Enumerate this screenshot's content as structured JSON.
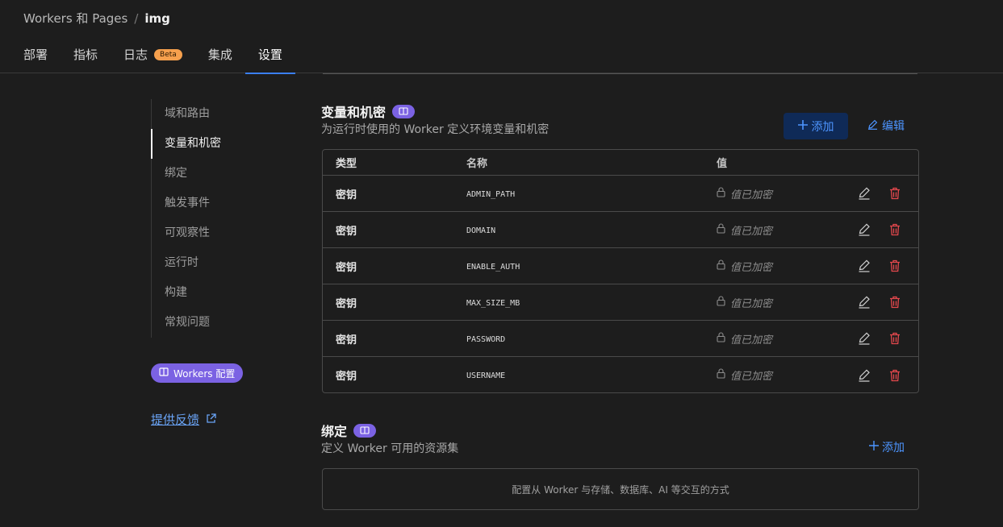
{
  "breadcrumb": {
    "parent": "Workers 和 Pages",
    "separator": "/",
    "current": "img"
  },
  "tabs": [
    {
      "label": "部署"
    },
    {
      "label": "指标"
    },
    {
      "label": "日志",
      "badge": "Beta"
    },
    {
      "label": "集成"
    },
    {
      "label": "设置",
      "active": true
    }
  ],
  "sidenav": {
    "items": [
      {
        "label": "域和路由"
      },
      {
        "label": "变量和机密",
        "active": true
      },
      {
        "label": "绑定"
      },
      {
        "label": "触发事件"
      },
      {
        "label": "可观察性"
      },
      {
        "label": "运行时"
      },
      {
        "label": "构建"
      },
      {
        "label": "常规问题"
      }
    ],
    "workers_badge": "Workers 配置",
    "feedback": "提供反馈"
  },
  "variables": {
    "title": "变量和机密",
    "subtitle": "为运行时使用的 Worker 定义环境变量和机密",
    "add_label": "添加",
    "edit_label": "编辑",
    "columns": {
      "type": "类型",
      "name": "名称",
      "value": "值"
    },
    "rows": [
      {
        "type": "密钥",
        "name": "ADMIN_PATH",
        "value": "值已加密"
      },
      {
        "type": "密钥",
        "name": "DOMAIN",
        "value": "值已加密"
      },
      {
        "type": "密钥",
        "name": "ENABLE_AUTH",
        "value": "值已加密"
      },
      {
        "type": "密钥",
        "name": "MAX_SIZE_MB",
        "value": "值已加密"
      },
      {
        "type": "密钥",
        "name": "PASSWORD",
        "value": "值已加密"
      },
      {
        "type": "密钥",
        "name": "USERNAME",
        "value": "值已加密"
      }
    ]
  },
  "bindings": {
    "title": "绑定",
    "subtitle": "定义 Worker 可用的资源集",
    "add_label": "添加",
    "empty_text": "配置从 Worker 与存储、数据库、AI 等交互的方式"
  },
  "colors": {
    "accent": "#3b7ff0",
    "link": "#4d95ff",
    "badge": "#7b62e3",
    "danger": "#e5484d",
    "beta": "#f6a04d"
  }
}
